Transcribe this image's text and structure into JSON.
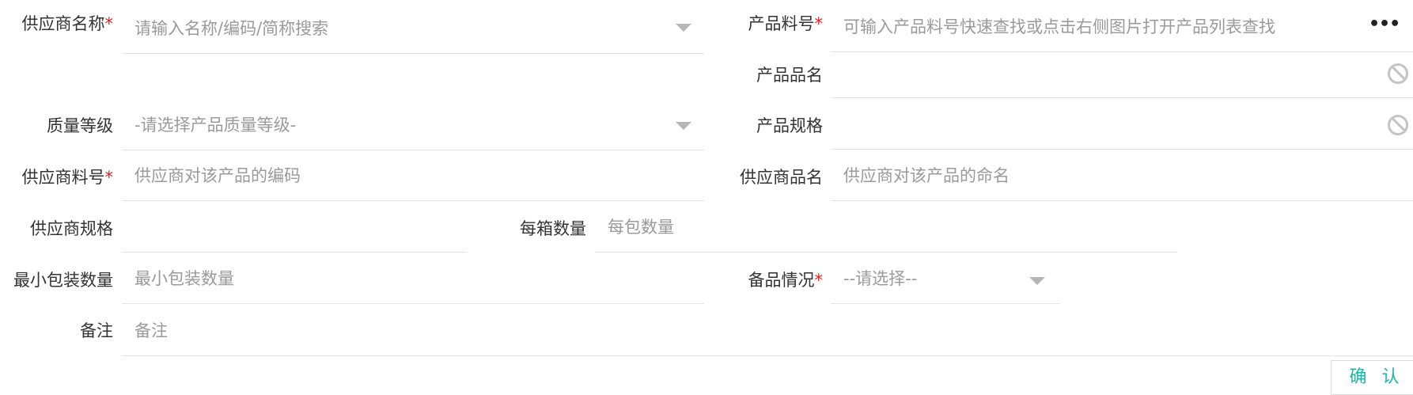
{
  "form": {
    "supplier_name": {
      "label": "供应商名称",
      "required": "*",
      "placeholder": "请输入名称/编码/简称搜索"
    },
    "product_no": {
      "label": "产品料号",
      "required": "*",
      "placeholder": "可输入产品料号快速查找或点击右侧图片打开产品列表查找",
      "more_icon": "•••"
    },
    "product_name": {
      "label": "产品品名",
      "value": ""
    },
    "quality_grade": {
      "label": "质量等级",
      "placeholder": "-请选择产品质量等级-"
    },
    "product_spec": {
      "label": "产品规格",
      "value": ""
    },
    "supplier_part_no": {
      "label": "供应商料号",
      "required": "*",
      "placeholder": "供应商对该产品的编码"
    },
    "supplier_product_name": {
      "label": "供应商品名",
      "placeholder": "供应商对该产品的命名"
    },
    "supplier_spec": {
      "label": "供应商规格",
      "value": ""
    },
    "per_box_qty": {
      "label": "每箱数量",
      "placeholder": "每包数量"
    },
    "min_pack_qty": {
      "label": "最小包装数量",
      "placeholder": "最小包装数量"
    },
    "spare_status": {
      "label": "备品情况",
      "required": "*",
      "placeholder": "--请选择--"
    },
    "remark": {
      "label": "备注",
      "placeholder": "备注"
    }
  },
  "actions": {
    "confirm": "确 认"
  },
  "colors": {
    "accent": "#21b5a6",
    "required": "#e02020",
    "placeholder": "#9a9a9a",
    "border": "#e4e4e4"
  }
}
